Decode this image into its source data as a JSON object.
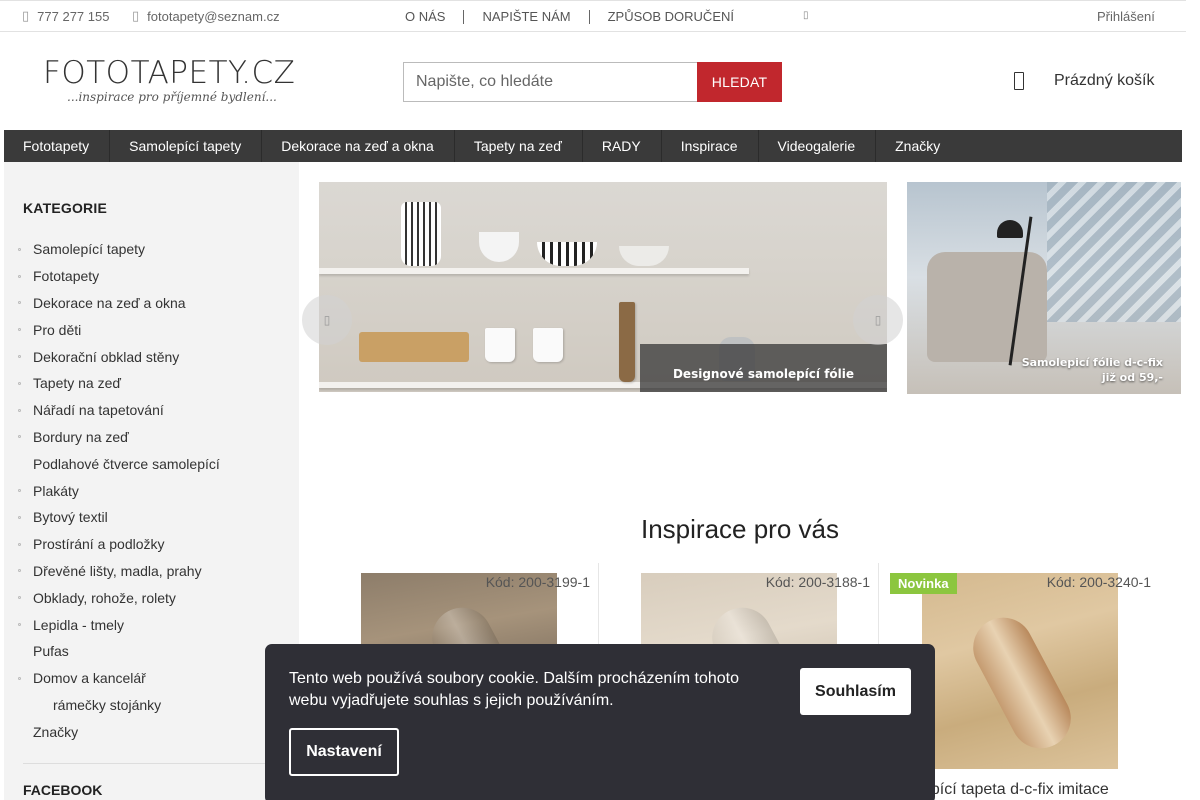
{
  "topbar": {
    "phone": "777 277 155",
    "email": "fototapety@seznam.cz",
    "links": [
      "O NÁS",
      "NAPIŠTE NÁM",
      "ZPŮSOB DORUČENÍ"
    ],
    "login": "Přihlášení"
  },
  "header": {
    "logo_main": "FOTOTAPETY.CZ",
    "logo_sub": "...inspirace pro příjemné bydlení...",
    "search_placeholder": "Napište, co hledáte",
    "search_button": "HLEDAT",
    "cart_label": "Prázdný košík"
  },
  "nav": [
    "Fototapety",
    "Samolepící tapety",
    "Dekorace na zeď a okna",
    "Tapety na zeď",
    "RADY",
    "Inspirace",
    "Videogalerie",
    "Značky"
  ],
  "sidebar": {
    "title": "KATEGORIE",
    "items": [
      {
        "label": "Samolepící tapety",
        "bullet": true,
        "sub": false
      },
      {
        "label": "Fototapety",
        "bullet": true,
        "sub": false
      },
      {
        "label": "Dekorace na zeď a okna",
        "bullet": true,
        "sub": false
      },
      {
        "label": "Pro děti",
        "bullet": true,
        "sub": false
      },
      {
        "label": "Dekorační obklad stěny",
        "bullet": true,
        "sub": false
      },
      {
        "label": "Tapety na zeď",
        "bullet": true,
        "sub": false
      },
      {
        "label": "Nářadí na tapetování",
        "bullet": true,
        "sub": false
      },
      {
        "label": "Bordury na zeď",
        "bullet": true,
        "sub": false
      },
      {
        "label": "Podlahové čtverce samolepící",
        "bullet": false,
        "sub": false
      },
      {
        "label": "Plakáty",
        "bullet": true,
        "sub": false
      },
      {
        "label": "Bytový textil",
        "bullet": true,
        "sub": false
      },
      {
        "label": "Prostírání a podložky",
        "bullet": true,
        "sub": false
      },
      {
        "label": "Dřevěné lišty, madla, prahy",
        "bullet": true,
        "sub": false
      },
      {
        "label": "Obklady, rohože, rolety",
        "bullet": true,
        "sub": false
      },
      {
        "label": "Lepidla - tmely",
        "bullet": true,
        "sub": false
      },
      {
        "label": "Pufas",
        "bullet": false,
        "sub": false
      },
      {
        "label": "Domov a kancelář",
        "bullet": true,
        "sub": false
      },
      {
        "label": "rámečky stojánky",
        "bullet": false,
        "sub": true
      },
      {
        "label": "Značky",
        "bullet": false,
        "sub": false
      }
    ],
    "facebook_title": "FACEBOOK"
  },
  "banners": {
    "main_caption": "Designové samolepící fólie",
    "side_caption_line1": "Samolepicí fólie d-c-fix",
    "side_caption_line2": "již od 59,-"
  },
  "inspiration": {
    "title": "Inspirace pro vás",
    "products": [
      {
        "code": "Kód: 200-3199-1",
        "badge": "",
        "title": ""
      },
      {
        "code": "Kód: 200-3188-1",
        "badge": "",
        "title": ""
      },
      {
        "code": "Kód: 200-3240-1",
        "badge": "Novinka",
        "title": "epící tapeta d-c-fix imitace"
      }
    ]
  },
  "cookie": {
    "text": "Tento web používá soubory cookie. Dalším procházením tohoto webu vyjadřujete souhlas s jejich používáním.",
    "accept": "Souhlasím",
    "settings": "Nastavení"
  },
  "colors": {
    "accent": "#c1272d",
    "nav_bg": "#3a3a3a",
    "badge_green": "#8cc63f",
    "cookie_bg": "#2f2f36"
  }
}
